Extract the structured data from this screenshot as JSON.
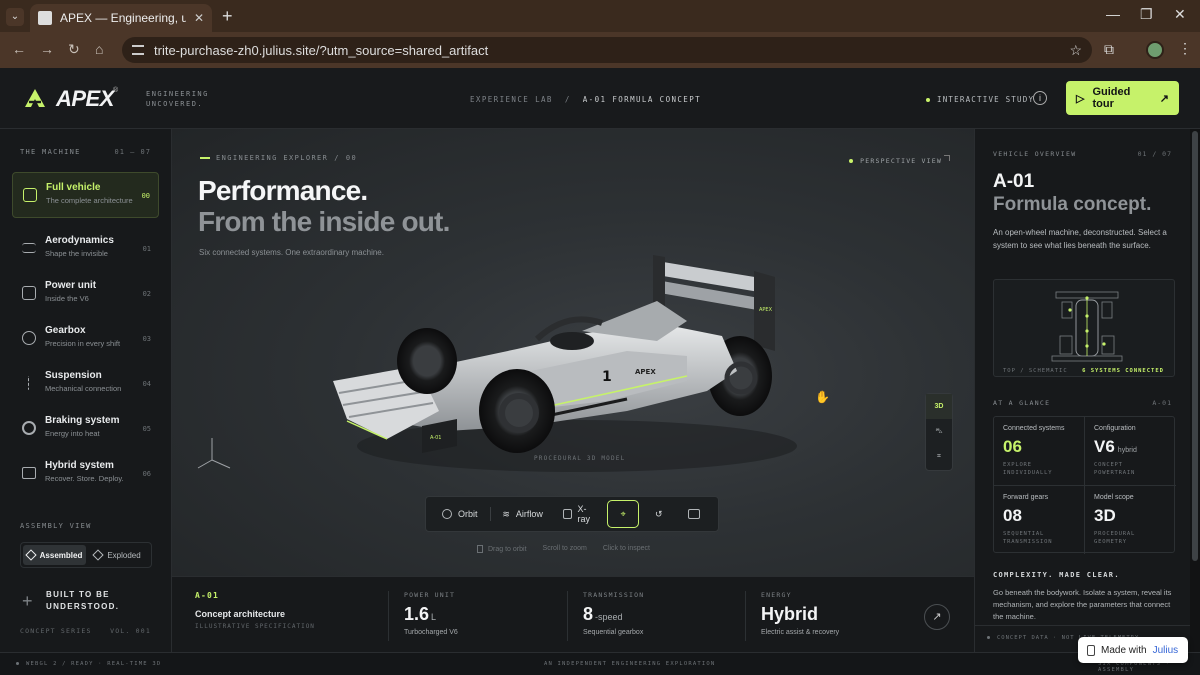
{
  "browser": {
    "tab_title": "APEX — Engineering, uncovered",
    "url": "trite-purchase-zh0.julius.site/?utm_source=shared_artifact"
  },
  "header": {
    "logo": "APEX",
    "logo_sup": "®",
    "tagline_1": "ENGINEERING",
    "tagline_2": "UNCOVERED.",
    "crumb_1": "EXPERIENCE LAB",
    "crumb_sep": "/",
    "crumb_2": "A-01 FORMULA CONCEPT",
    "study": "INTERACTIVE STUDY",
    "tour_label": "Guided tour",
    "accent": "#c6f26a"
  },
  "sidebar": {
    "heading": "THE MACHINE",
    "count": "01 — 07",
    "items": [
      {
        "title": "Full vehicle",
        "sub": "The complete architecture",
        "num": "00",
        "icon": "cube-icon"
      },
      {
        "title": "Aerodynamics",
        "sub": "Shape the invisible",
        "num": "01",
        "icon": "wind-icon"
      },
      {
        "title": "Power unit",
        "sub": "Inside the V6",
        "num": "02",
        "icon": "engine-icon"
      },
      {
        "title": "Gearbox",
        "sub": "Precision in every shift",
        "num": "03",
        "icon": "gear-icon"
      },
      {
        "title": "Suspension",
        "sub": "Mechanical connection",
        "num": "04",
        "icon": "spring-icon"
      },
      {
        "title": "Braking system",
        "sub": "Energy into heat",
        "num": "05",
        "icon": "brake-disc-icon"
      },
      {
        "title": "Hybrid system",
        "sub": "Recover. Store. Deploy.",
        "num": "06",
        "icon": "battery-icon"
      }
    ],
    "assembly_heading": "ASSEMBLY VIEW",
    "assembled": "Assembled",
    "exploded": "Exploded",
    "built": "BUILT TO BE UNDERSTOOD.",
    "concept_series": "CONCEPT SERIES",
    "volume": "VOL. 001"
  },
  "stage": {
    "explorer_label": "ENGINEERING EXPLORER",
    "explorer_sep": "/",
    "explorer_num": "00",
    "perspective": "PERSPECTIVE VIEW",
    "headline_1": "Performance.",
    "headline_2": "From the inside out.",
    "sub": "Six connected systems. One extraordinary machine.",
    "car_livery_text": "APEX",
    "car_number": "1",
    "nose_label": "A-01",
    "model_caption": "PROCEDURAL 3D MODEL",
    "view_3d": "3D",
    "toolbar": {
      "orbit": "Orbit",
      "airflow": "Airflow",
      "xray": "X-ray"
    },
    "hints": [
      "Drag to orbit",
      "Scroll to zoom",
      "Click to inspect"
    ]
  },
  "specs": [
    {
      "label": "A-01",
      "title": "Concept architecture",
      "desc": "ILLUSTRATIVE SPECIFICATION"
    },
    {
      "label": "POWER UNIT",
      "value": "1.6",
      "unit": "L",
      "desc": "Turbocharged V6"
    },
    {
      "label": "TRANSMISSION",
      "value": "8",
      "unit": "-speed",
      "desc": "Sequential gearbox"
    },
    {
      "label": "ENERGY",
      "value": "Hybrid",
      "desc": "Electric assist & recovery"
    }
  ],
  "right": {
    "heading": "VEHICLE OVERVIEW",
    "count": "01 / 07",
    "title_1": "A-01",
    "title_2": "Formula concept.",
    "desc": "An open-wheel machine, deconstructed. Select a system to see what lies beneath the surface.",
    "schematic_caption": "TOP / SCHEMATIC",
    "systems_connected": "6 SYSTEMS CONNECTED",
    "glance_heading": "AT A GLANCE",
    "glance_code": "A-01",
    "glance": [
      {
        "label": "Connected systems",
        "value": "06",
        "small": "",
        "desc": "EXPLORE INDIVIDUALLY"
      },
      {
        "label": "Configuration",
        "value": "V6",
        "small": "hybrid",
        "desc": "CONCEPT POWERTRAIN"
      },
      {
        "label": "Forward gears",
        "value": "08",
        "small": "",
        "desc": "SEQUENTIAL TRANSMISSION"
      },
      {
        "label": "Model scope",
        "value": "3D",
        "small": "",
        "desc": "PROCEDURAL GEOMETRY"
      }
    ],
    "complexity_heading": "COMPLEXITY. MADE CLEAR.",
    "complexity_desc": "Go beneath the bodywork. Isolate a system, reveal its mechanism, and explore the parameters that connect the machine.",
    "footer": "CONCEPT DATA · NOT LIVE TELEMETRY"
  },
  "status": {
    "left": "WEBGL 2 / READY   ·   REAL-TIME 3D",
    "mid": "AN INDEPENDENT ENGINEERING EXPLORATION",
    "right": "SIX COMPONENTS · ASSEMBLY"
  },
  "made_with": {
    "label": "Made with",
    "brand": "Julius"
  }
}
